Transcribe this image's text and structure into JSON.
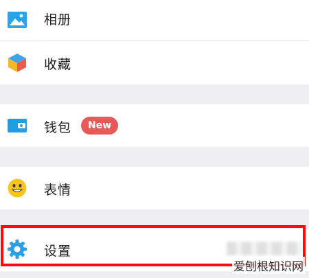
{
  "menu": {
    "items": [
      {
        "label": "相册"
      },
      {
        "label": "收藏"
      },
      {
        "label": "钱包",
        "badge": "New"
      },
      {
        "label": "表情"
      },
      {
        "label": "设置"
      }
    ]
  },
  "watermark": {
    "text": "爱刨根知识网"
  },
  "colors": {
    "accent_blue": "#1f9ee8",
    "badge_red": "#e85a59",
    "highlight_red": "#ff0a0a",
    "section_gap": "#efeef1"
  }
}
